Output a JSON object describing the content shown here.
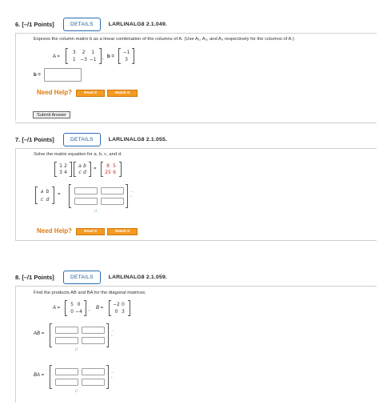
{
  "q6": {
    "points": "6. [–/1 Points]",
    "details": "DETAILS",
    "code": "LARLINALG8 2.1.049.",
    "prompt": "Express the column matrix b as a linear combination of the columns of A. (Use A₁, A₂, and A₃ respectively for the columns of A.)",
    "A_label": "A =",
    "A": [
      [
        "3",
        "2",
        "1"
      ],
      [
        "1",
        "−3",
        "−1"
      ]
    ],
    "b_label": "b =",
    "b": [
      "−1",
      "3"
    ],
    "answer_label": "b =",
    "need_help": "Need Help?",
    "read_it": "Read It",
    "watch_it": "Watch It",
    "submit": "Submit Answer"
  },
  "q7": {
    "points": "7. [–/1 Points]",
    "details": "DETAILS",
    "code": "LARLINALG8 2.1.055.",
    "prompt": "Solve the matrix equation for a, b, c, and d.",
    "M1": [
      [
        "1",
        "2"
      ],
      [
        "3",
        "4"
      ]
    ],
    "M2": [
      [
        "a",
        "b"
      ],
      [
        "c",
        "d"
      ]
    ],
    "eq": "=",
    "M3": [
      [
        "8",
        "5"
      ],
      [
        "25",
        "6"
      ]
    ],
    "abcd": [
      [
        "a",
        "b"
      ],
      [
        "c",
        "d"
      ]
    ],
    "need_help": "Need Help?",
    "read_it": "Read It",
    "watch_it": "Watch It"
  },
  "q8": {
    "points": "8. [–/1 Points]",
    "details": "DETAILS",
    "code": "LARLINALG8 2.1.059.",
    "prompt": "Find the products AB and BA for the diagonal matrices.",
    "A_label": "A =",
    "A": [
      [
        "5",
        "0"
      ],
      [
        "0",
        "−4"
      ]
    ],
    "comma": ",",
    "B_label": "B =",
    "B": [
      [
        "−2",
        "0"
      ],
      [
        "0",
        "3"
      ]
    ],
    "AB_label": "AB =",
    "BA_label": "BA ="
  },
  "colors": {
    "accent": "#2a6db3",
    "orange": "#f59a22",
    "help": "#e07a10",
    "green": "#3aa64a"
  }
}
